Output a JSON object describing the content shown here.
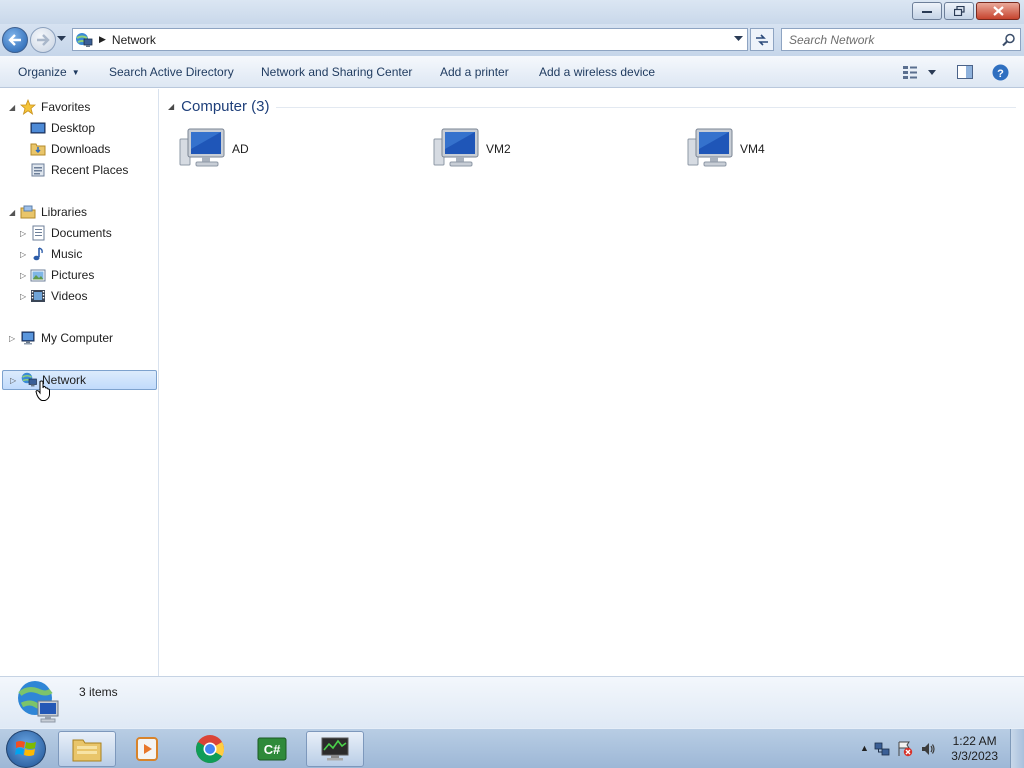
{
  "window": {
    "minimize_icon": "minimize-icon",
    "restore_icon": "restore-icon",
    "close_icon": "close-icon"
  },
  "address": {
    "location": "Network",
    "search_placeholder": "Search Network"
  },
  "toolbar": {
    "organize": "Organize",
    "search_ad": "Search Active Directory",
    "sharing_center": "Network and Sharing Center",
    "add_printer": "Add a printer",
    "add_wireless": "Add a wireless device"
  },
  "nav": {
    "favorites": "Favorites",
    "desktop": "Desktop",
    "downloads": "Downloads",
    "recent": "Recent Places",
    "libraries": "Libraries",
    "documents": "Documents",
    "music": "Music",
    "pictures": "Pictures",
    "videos": "Videos",
    "my_computer": "My Computer",
    "network": "Network"
  },
  "content": {
    "group_title": "Computer (3)",
    "items": [
      "AD",
      "VM2",
      "VM4"
    ]
  },
  "details": {
    "count": "3 items"
  },
  "taskbar": {
    "time": "1:22 AM",
    "date": "3/3/2023"
  },
  "colors": {
    "accent": "#1e3f7a",
    "selection": "#c1dbfc",
    "taskbar": "#9db7d6"
  }
}
